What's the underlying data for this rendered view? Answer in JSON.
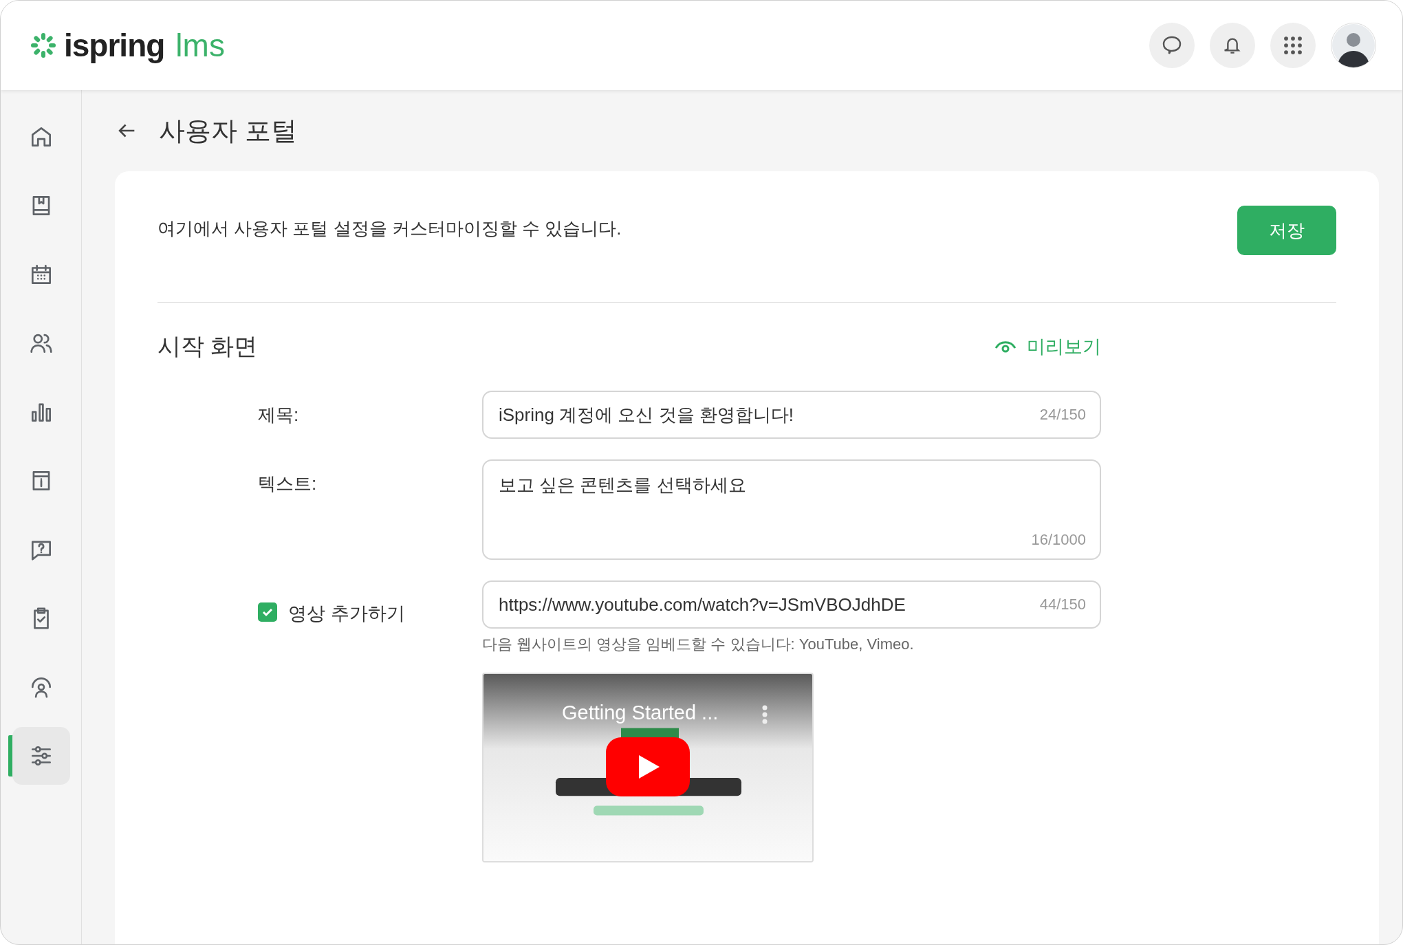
{
  "header": {
    "logo_text": "ispring",
    "logo_suffix": "lms"
  },
  "sidebar": {
    "items": [
      {
        "kind": "home",
        "selected": false
      },
      {
        "kind": "book",
        "selected": false
      },
      {
        "kind": "calendar",
        "selected": false
      },
      {
        "kind": "users",
        "selected": false
      },
      {
        "kind": "chart",
        "selected": false
      },
      {
        "kind": "info",
        "selected": false
      },
      {
        "kind": "question",
        "selected": false
      },
      {
        "kind": "clipboard",
        "selected": false
      },
      {
        "kind": "person",
        "selected": false
      },
      {
        "kind": "sliders",
        "selected": true
      }
    ]
  },
  "page": {
    "title": "사용자 포털",
    "description": "여기에서 사용자 포털 설정을 커스터마이징할 수 있습니다.",
    "save_button": "저장"
  },
  "section": {
    "title": "시작 화면",
    "preview_link": "미리보기",
    "fields": [
      {
        "kind": "input",
        "label": "제목:",
        "value": "iSpring 계정에 오신 것을 환영합니다!",
        "counter": "24/150"
      },
      {
        "kind": "textarea",
        "label": "텍스트:",
        "value": "보고 싶은 콘텐츠를 선택하세요",
        "counter": "16/1000"
      },
      {
        "kind": "checkbox-input",
        "label": "영상 추가하기",
        "checked": true,
        "value": "https://www.youtube.com/watch?v=JSmVBOJdhDE",
        "counter": "44/150",
        "hint": "다음 웹사이트의 영상을 임베드할 수 있습니다: YouTube, Vimeo."
      }
    ],
    "video": {
      "title": "Getting Started ..."
    }
  }
}
